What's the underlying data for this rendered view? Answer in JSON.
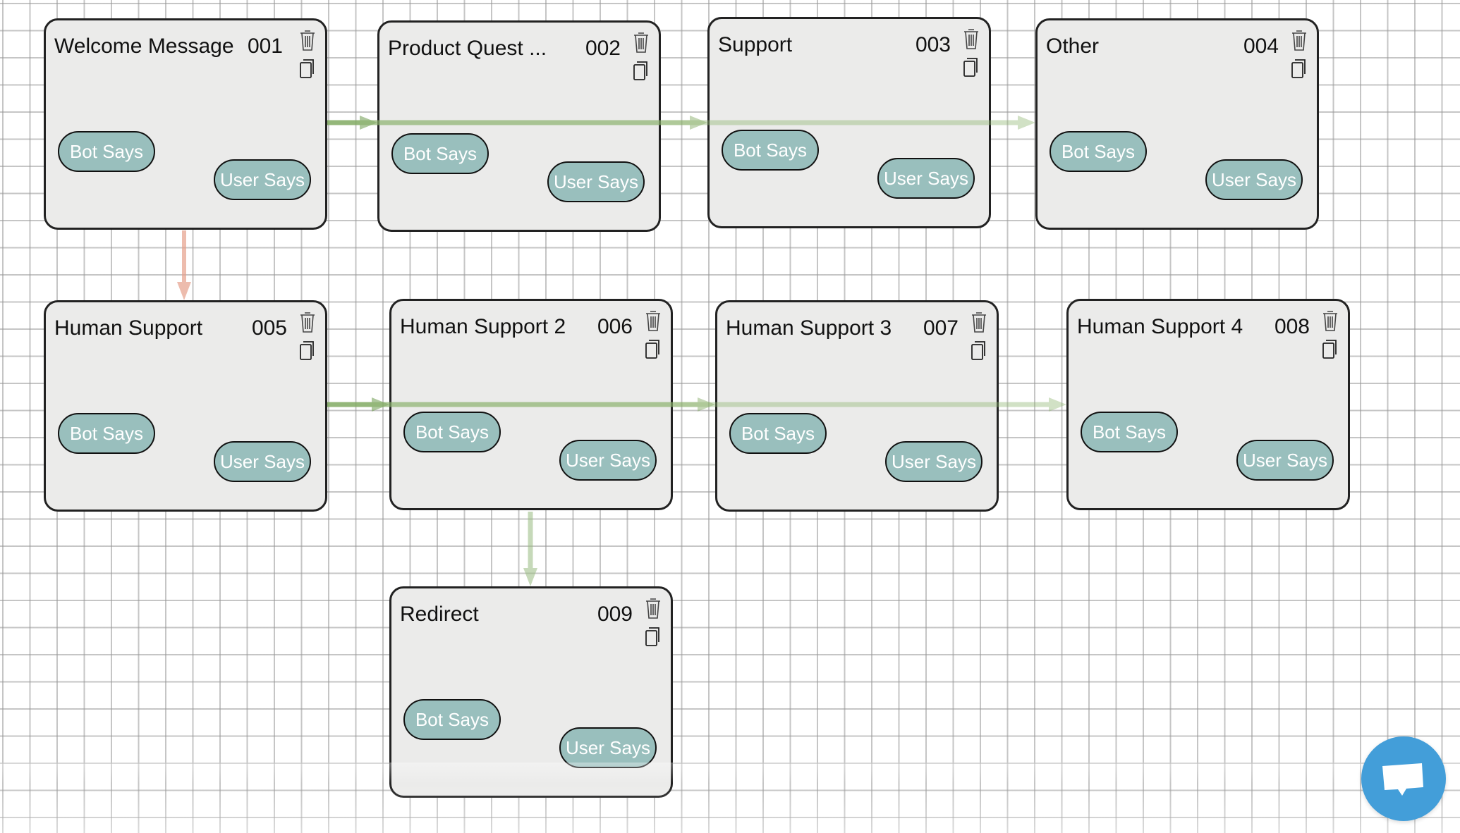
{
  "canvas": {
    "grid": true
  },
  "colors": {
    "node_background": "#ebebea",
    "node_border": "#222222",
    "pill_background": "#99bfbd",
    "pill_text": "#ffffff",
    "link_green": "#8bb070",
    "link_green_light": "#b5cda3",
    "link_pink": "#eab3a3",
    "chat_button": "#439ed9"
  },
  "nodes": [
    {
      "title": "Welcome Message",
      "id": "001",
      "bot_label": "Bot Says",
      "user_label": "User Says"
    },
    {
      "title": "Product Quest ...",
      "id": "002",
      "bot_label": "Bot Says",
      "user_label": "User Says"
    },
    {
      "title": "Support",
      "id": "003",
      "bot_label": "Bot Says",
      "user_label": "User Says"
    },
    {
      "title": "Other",
      "id": "004",
      "bot_label": "Bot Says",
      "user_label": "User Says"
    },
    {
      "title": "Human Support",
      "id": "005",
      "bot_label": "Bot Says",
      "user_label": "User Says"
    },
    {
      "title": "Human Support 2",
      "id": "006",
      "bot_label": "Bot Says",
      "user_label": "User Says"
    },
    {
      "title": "Human Support 3",
      "id": "007",
      "bot_label": "Bot Says",
      "user_label": "User Says"
    },
    {
      "title": "Human Support 4",
      "id": "008",
      "bot_label": "Bot Says",
      "user_label": "User Says"
    },
    {
      "title": "Redirect",
      "id": "009",
      "bot_label": "Bot Says",
      "user_label": "User Says"
    }
  ],
  "links": [
    {
      "from": "001",
      "to": "002",
      "color": "green"
    },
    {
      "from": "001",
      "to": "003",
      "color": "green"
    },
    {
      "from": "001",
      "to": "004",
      "color": "green"
    },
    {
      "from": "001",
      "to": "005",
      "color": "pink"
    },
    {
      "from": "005",
      "to": "006",
      "color": "green"
    },
    {
      "from": "005",
      "to": "007",
      "color": "green"
    },
    {
      "from": "005",
      "to": "008",
      "color": "green"
    },
    {
      "from": "006",
      "to": "009",
      "color": "green-light"
    }
  ],
  "icons": {
    "delete": "trash-icon",
    "duplicate": "copy-icon",
    "chat": "chat-bubble-icon"
  }
}
